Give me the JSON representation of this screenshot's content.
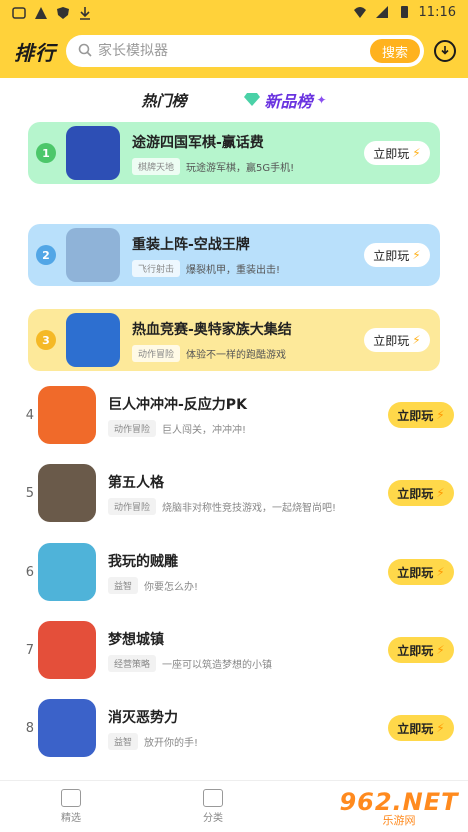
{
  "status": {
    "time": "11:16"
  },
  "header": {
    "logo": "排行",
    "search_placeholder": "家长模拟器",
    "search_button": "搜索"
  },
  "tabs": [
    {
      "label": "热门榜"
    },
    {
      "label": "新品榜"
    }
  ],
  "play_label": "立即玩",
  "top_games": [
    {
      "rank": "1",
      "title": "途游四国军棋-赢话费",
      "tag": "棋牌天地",
      "desc": "玩途游军棋，赢5G手机!",
      "bg": "#b6f5cd",
      "badge": "#4cc76a",
      "icon_color": "#2d4fb5"
    },
    {
      "rank": "2",
      "title": "重装上阵-空战王牌",
      "tag": "飞行射击",
      "desc": "爆裂机甲，重装出击!",
      "bg": "#b9e0fb",
      "badge": "#52a6e6",
      "icon_color": "#8fb3d8"
    },
    {
      "rank": "3",
      "title": "热血竞赛-奥特家族大集结",
      "tag": "动作冒险",
      "desc": "体验不一样的跑酷游戏",
      "bg": "#fde99a",
      "badge": "#f5b926",
      "icon_color": "#2d6fd0"
    }
  ],
  "games": [
    {
      "rank": "4",
      "title": "巨人冲冲冲-反应力PK",
      "tag": "动作冒险",
      "desc": "巨人闯关，冲冲冲!",
      "icon_color": "#f06a2a"
    },
    {
      "rank": "5",
      "title": "第五人格",
      "tag": "动作冒险",
      "desc": "烧脑非对称性竞技游戏，一起烧智尚吧!",
      "icon_color": "#6a5a4a"
    },
    {
      "rank": "6",
      "title": "我玩的贼雕",
      "tag": "益智",
      "desc": "你要怎么办!",
      "icon_color": "#4fb3d9"
    },
    {
      "rank": "7",
      "title": "梦想城镇",
      "tag": "经营策略",
      "desc": "一座可以筑造梦想的小镇",
      "icon_color": "#e44f3a"
    },
    {
      "rank": "8",
      "title": "消灭恶势力",
      "tag": "益智",
      "desc": "放开你的手!",
      "icon_color": "#3b62c9"
    }
  ],
  "bottom_nav": [
    {
      "label": "精选"
    },
    {
      "label": "分类"
    }
  ],
  "watermark": {
    "big": "962.NET",
    "small": "乐游网"
  }
}
